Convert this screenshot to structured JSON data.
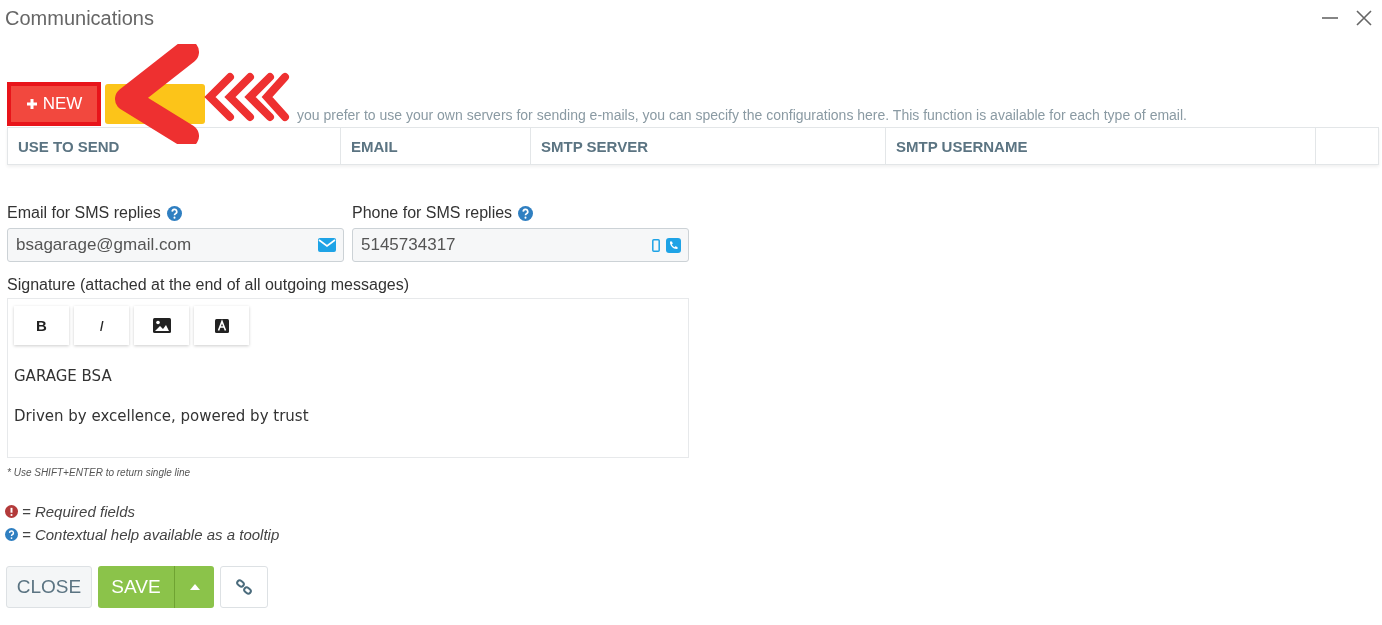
{
  "window": {
    "title": "Communications"
  },
  "toolbar": {
    "new_button": "NEW",
    "description": "you prefer to use your own servers for sending e-mails, you can specify the configurations here. This function is available for each type of email."
  },
  "table": {
    "columns": [
      "USE TO SEND",
      "EMAIL",
      "SMTP SERVER",
      "SMTP USERNAME"
    ]
  },
  "email_field": {
    "label": "Email for SMS replies",
    "value": "bsagarage@gmail.com"
  },
  "phone_field": {
    "label": "Phone for SMS replies",
    "value": "5145734317"
  },
  "signature": {
    "label": "Signature (attached at the end of all outgoing messages)",
    "format_buttons": [
      {
        "kind": "bold",
        "label": "B"
      },
      {
        "kind": "italic",
        "label": "I"
      },
      {
        "kind": "image"
      },
      {
        "kind": "font"
      }
    ],
    "lines": [
      "GARAGE BSA",
      "Driven by excellence, powered by trust"
    ],
    "hint": "* Use SHIFT+ENTER to return single line"
  },
  "legend": [
    "= Required fields",
    "= Contextual help available as a tooltip"
  ],
  "footer": {
    "close": "CLOSE",
    "save": "SAVE"
  }
}
